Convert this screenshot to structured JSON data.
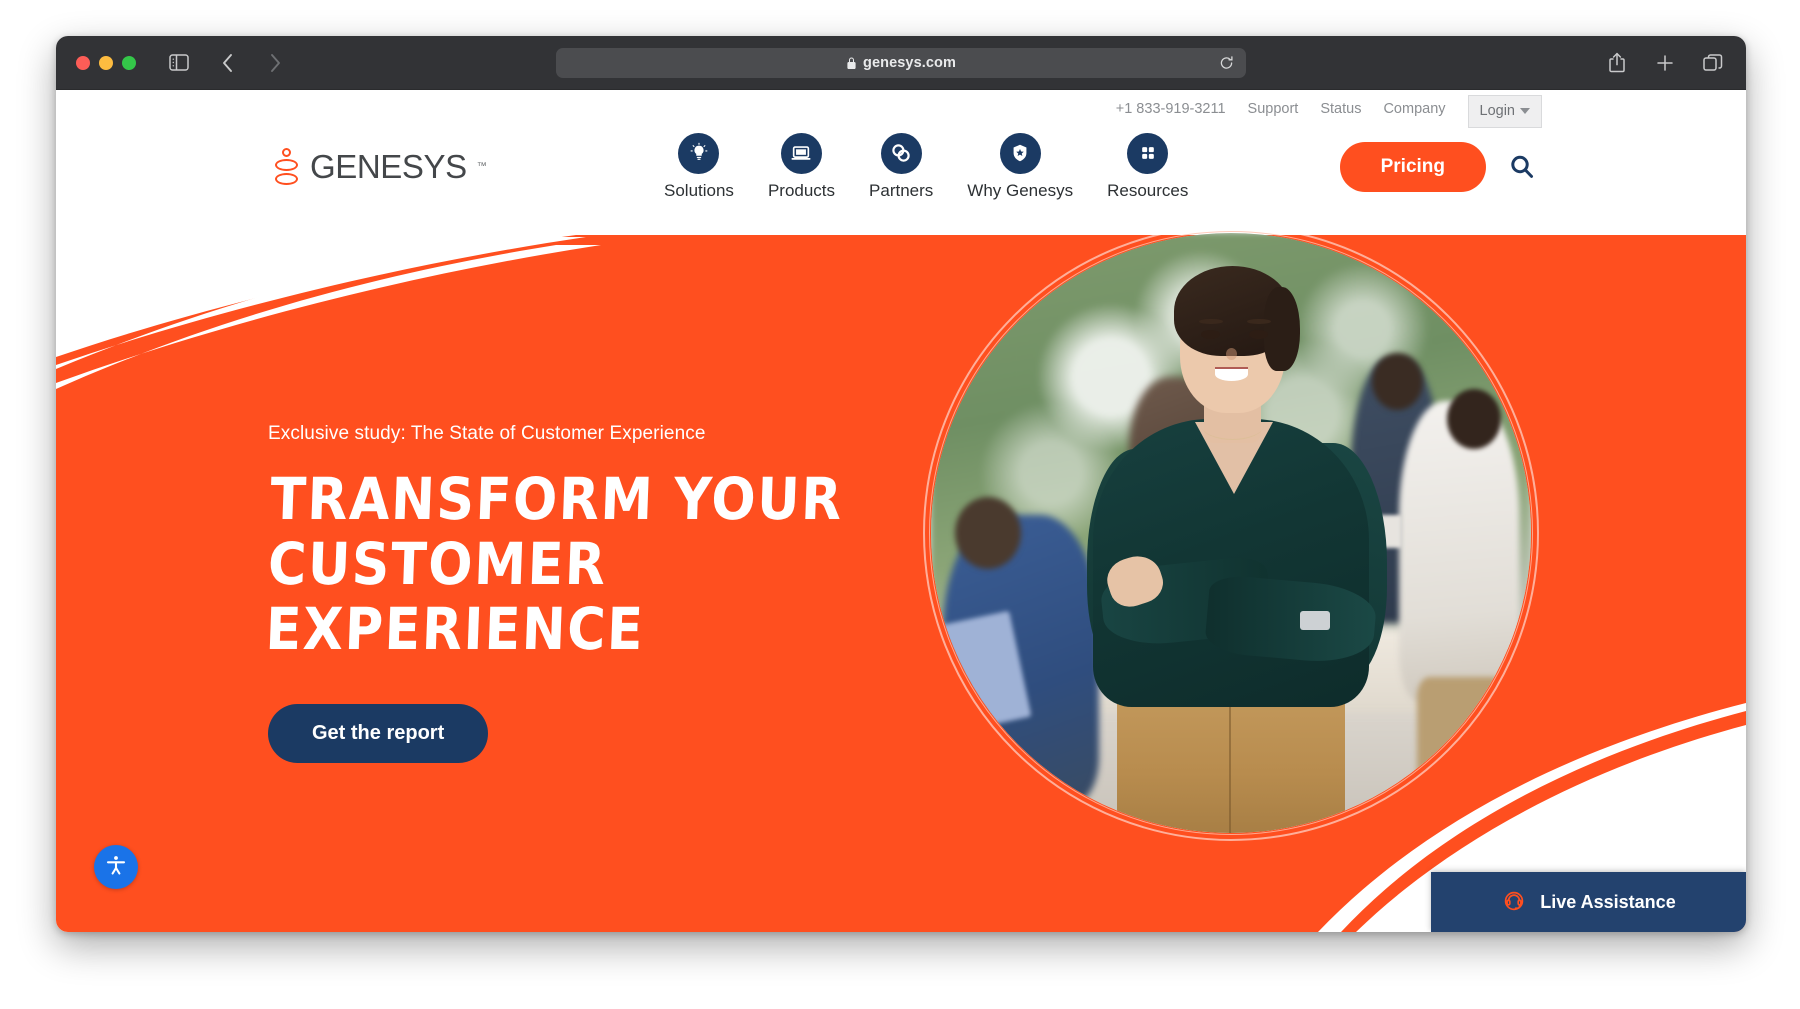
{
  "browser": {
    "url": "genesys.com",
    "lock_icon": "lock-icon",
    "reload_icon": "reload-icon",
    "sidebar_icon": "sidebar-toggle-icon",
    "back_icon": "back-arrow-icon",
    "forward_icon": "forward-arrow-icon",
    "shield_icon": "privacy-shield-icon",
    "share_icon": "share-icon",
    "newtab_icon": "plus-icon",
    "tabs_icon": "tab-overview-icon",
    "traffic_lights": [
      "close",
      "minimize",
      "zoom"
    ]
  },
  "utility_bar": {
    "phone": "+1 833-919-3211",
    "links": [
      "Support",
      "Status",
      "Company"
    ],
    "login_label": "Login"
  },
  "header": {
    "logo_text": "GENESYS",
    "logo_tm": "™",
    "nav": [
      {
        "label": "Solutions",
        "icon": "lightbulb-icon"
      },
      {
        "label": "Products",
        "icon": "laptop-icon"
      },
      {
        "label": "Partners",
        "icon": "linked-circles-icon"
      },
      {
        "label": "Why Genesys",
        "icon": "shield-star-icon"
      },
      {
        "label": "Resources",
        "icon": "grid-dots-icon"
      }
    ],
    "pricing_label": "Pricing",
    "search_icon": "search-icon"
  },
  "hero": {
    "eyebrow": "Exclusive study: The State of Customer Experience",
    "headline_line1": "Transform your",
    "headline_line2": "Customer Experience",
    "cta_label": "Get the report",
    "image_alt": "Smiling businesswoman with arms crossed in an office"
  },
  "widgets": {
    "accessibility_icon": "accessibility-person-icon",
    "live_assistance_label": "Live Assistance",
    "live_assistance_icon": "headset-icon"
  },
  "colors": {
    "brand_orange": "#ff4f1f",
    "brand_navy": "#1b3A63",
    "live_assist_navy": "#23426e",
    "chrome_dark": "#323336",
    "a11y_blue": "#1a73e8"
  }
}
